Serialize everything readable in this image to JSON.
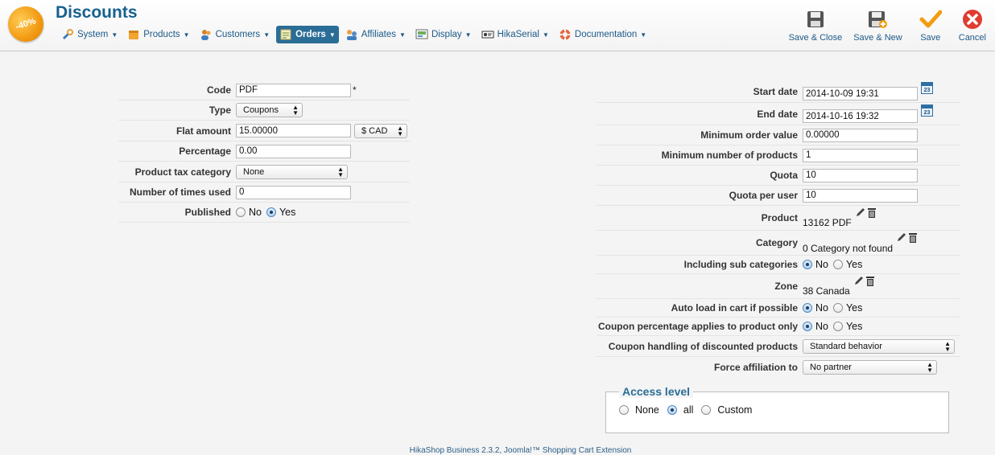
{
  "header": {
    "logo_text": "-40%",
    "title": "Discounts",
    "menu": [
      {
        "label": "System",
        "icon": "wrench-icon",
        "color": "#3f7fbf"
      },
      {
        "label": "Products",
        "icon": "box-icon",
        "color": "#f3a52f"
      },
      {
        "label": "Customers",
        "icon": "users-icon",
        "color": "#d9822b"
      },
      {
        "label": "Orders",
        "icon": "orders-icon",
        "color": "#e6d27a"
      },
      {
        "label": "Affiliates",
        "icon": "affiliates-icon",
        "color": "#5a8bc6"
      },
      {
        "label": "Display",
        "icon": "display-icon",
        "color": "#6fae5e"
      },
      {
        "label": "HikaSerial",
        "icon": "serial-icon",
        "color": "#555555"
      },
      {
        "label": "Documentation",
        "icon": "lifebuoy-icon",
        "color": "#e3673d"
      }
    ],
    "active_menu": "Orders",
    "toolbar": {
      "save_close": "Save & Close",
      "save_new": "Save & New",
      "save": "Save",
      "cancel": "Cancel"
    }
  },
  "left": {
    "code": {
      "label": "Code",
      "value": "PDF",
      "required_mark": "*"
    },
    "type": {
      "label": "Type",
      "value": "Coupons"
    },
    "flat_amount": {
      "label": "Flat amount",
      "value": "15.00000",
      "currency": "$ CAD"
    },
    "percentage": {
      "label": "Percentage",
      "value": "0.00"
    },
    "tax_category": {
      "label": "Product tax category",
      "value": "None"
    },
    "times_used": {
      "label": "Number of times used",
      "value": "0"
    },
    "published": {
      "label": "Published",
      "no": "No",
      "yes": "Yes",
      "selected": "Yes"
    }
  },
  "right": {
    "start_date": {
      "label": "Start date",
      "value": "2014-10-09 19:31"
    },
    "end_date": {
      "label": "End date",
      "value": "2014-10-16 19:32"
    },
    "min_order": {
      "label": "Minimum order value",
      "value": "0.00000"
    },
    "min_products": {
      "label": "Minimum number of products",
      "value": "1"
    },
    "quota": {
      "label": "Quota",
      "value": "10"
    },
    "quota_user": {
      "label": "Quota per user",
      "value": "10"
    },
    "product": {
      "label": "Product",
      "value": "13162 PDF"
    },
    "category": {
      "label": "Category",
      "value": "0 Category not found"
    },
    "sub_categories": {
      "label": "Including sub categories",
      "no": "No",
      "yes": "Yes",
      "selected": "No"
    },
    "zone": {
      "label": "Zone",
      "value": "38 Canada"
    },
    "auto_load": {
      "label": "Auto load in cart if possible",
      "no": "No",
      "yes": "Yes",
      "selected": "No"
    },
    "coupon_pct": {
      "label": "Coupon percentage applies to product only",
      "no": "No",
      "yes": "Yes",
      "selected": "No"
    },
    "coupon_handling": {
      "label": "Coupon handling of discounted products",
      "value": "Standard behavior"
    },
    "force_affiliation": {
      "label": "Force affiliation to",
      "value": "No partner"
    }
  },
  "access": {
    "legend": "Access level",
    "options": [
      "None",
      "all",
      "Custom"
    ],
    "selected": "all"
  },
  "footer": "HikaShop Business 2.3.2, Joomla!™ Shopping Cart Extension"
}
